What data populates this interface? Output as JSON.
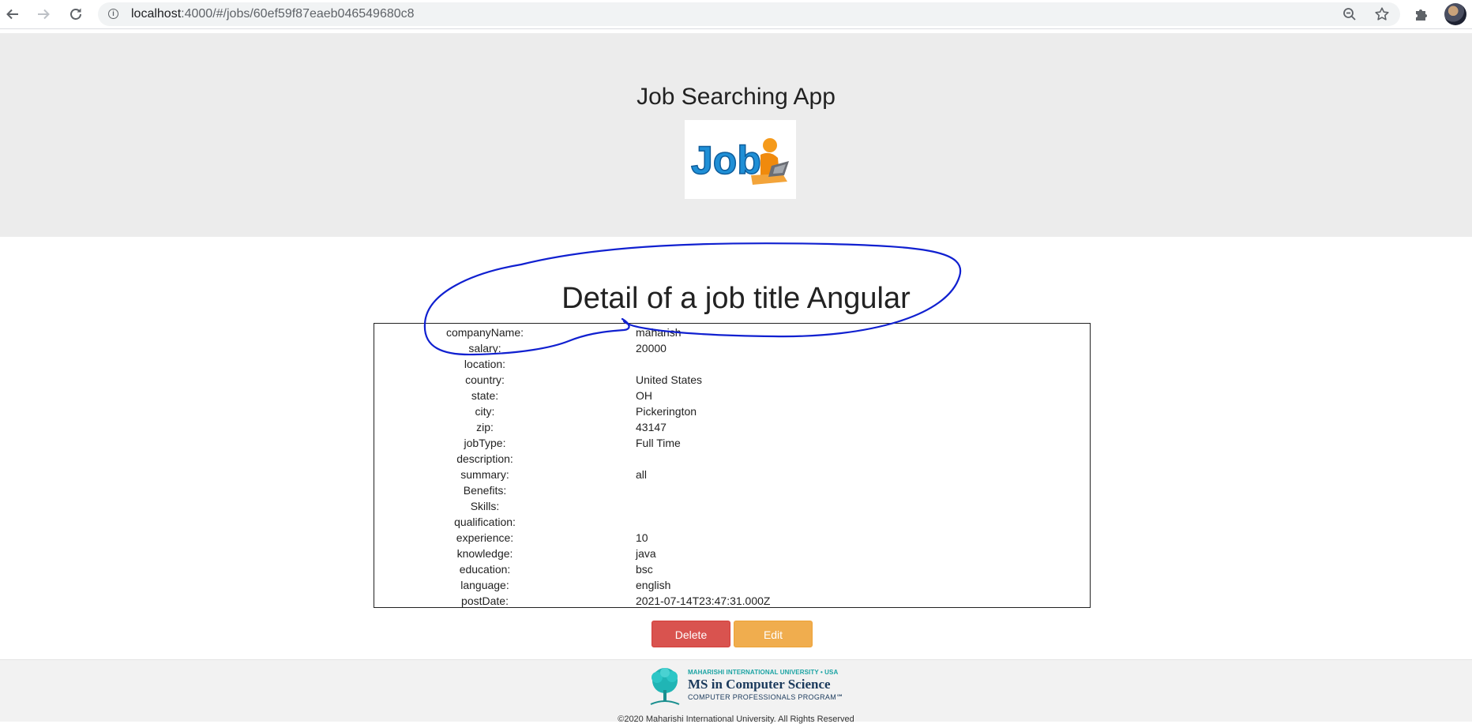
{
  "browser": {
    "url_host": "localhost",
    "url_path": ":4000/#/jobs/60ef59f87eaeb046549680c8",
    "icons": {
      "back": "back-arrow-icon",
      "forward": "forward-arrow-icon",
      "reload": "reload-icon",
      "site_info": "info-icon",
      "zoom": "zoom-out-icon",
      "bookmark": "star-icon",
      "extensions": "puzzle-icon",
      "profile": "avatar"
    }
  },
  "header": {
    "title": "Job Searching App",
    "logo_text": "Job"
  },
  "main": {
    "heading": "Detail of a job title Angular",
    "fields": [
      {
        "label": "companyName:",
        "value": "maharish"
      },
      {
        "label": "salary:",
        "value": "20000"
      },
      {
        "label": "location:",
        "value": ""
      },
      {
        "label": "country:",
        "value": "United States"
      },
      {
        "label": "state:",
        "value": "OH"
      },
      {
        "label": "city:",
        "value": "Pickerington"
      },
      {
        "label": "zip:",
        "value": "43147"
      },
      {
        "label": "jobType:",
        "value": "Full Time"
      },
      {
        "label": "description:",
        "value": ""
      },
      {
        "label": "summary:",
        "value": "all"
      },
      {
        "label": "Benefits:",
        "value": ""
      },
      {
        "label": "Skills:",
        "value": ""
      },
      {
        "label": "qualification:",
        "value": ""
      },
      {
        "label": "experience:",
        "value": "10"
      },
      {
        "label": "knowledge:",
        "value": "java"
      },
      {
        "label": "education:",
        "value": "bsc"
      },
      {
        "label": "language:",
        "value": "english"
      },
      {
        "label": "postDate:",
        "value": "2021-07-14T23:47:31.000Z"
      }
    ],
    "delete_label": "Delete",
    "edit_label": "Edit"
  },
  "footer": {
    "university": "MAHARISHI INTERNATIONAL UNIVERSITY • USA",
    "program": "MS in Computer Science",
    "program_sub": "COMPUTER PROFESSIONALS PROGRAM℠",
    "copyright": "©2020 Maharishi International University. All Rights Reserved"
  },
  "colors": {
    "delete": "#d9534f",
    "edit": "#f0ad4e",
    "header_bg": "#ececec",
    "annotation": "#1020d0"
  }
}
